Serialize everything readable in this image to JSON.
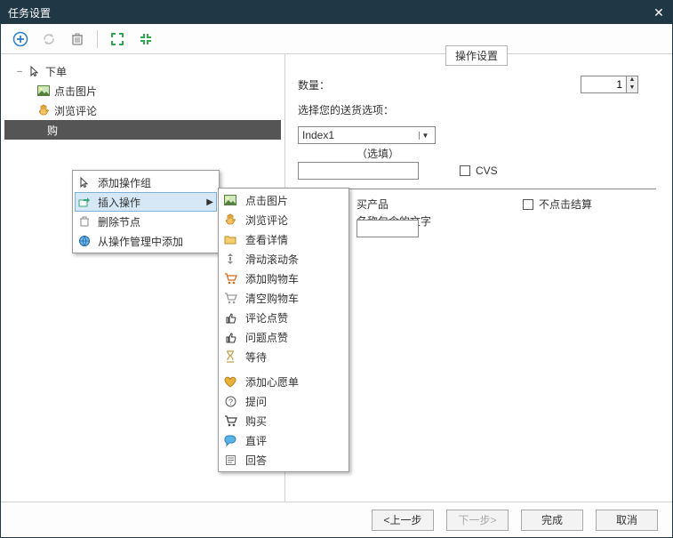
{
  "window": {
    "title": "任务设置"
  },
  "toolbar": {
    "items": [
      "add",
      "sync",
      "trash",
      "sep",
      "fit-green",
      "fit-green-2"
    ]
  },
  "tree": {
    "root": {
      "label": "下单",
      "icon": "cursor"
    },
    "children": [
      {
        "label": "点击图片",
        "icon": "image"
      },
      {
        "label": "浏览评论",
        "icon": "hand"
      },
      {
        "label": "购",
        "icon": "cart",
        "selected": true
      }
    ]
  },
  "context_menu": {
    "items": [
      {
        "label": "添加操作组",
        "icon": "cursor"
      },
      {
        "label": "插入操作",
        "icon": "insert",
        "submenu": true,
        "hover": true
      },
      {
        "label": "删除节点",
        "icon": "trash"
      },
      {
        "label": "从操作管理中添加",
        "icon": "globe"
      }
    ]
  },
  "sub_menu": {
    "items": [
      {
        "label": "点击图片",
        "icon": "image"
      },
      {
        "label": "浏览评论",
        "icon": "hand"
      },
      {
        "label": "查看详情",
        "icon": "folder"
      },
      {
        "label": "滑动滚动条",
        "icon": "scroll"
      },
      {
        "label": "添加购物车",
        "icon": "cart-add"
      },
      {
        "label": "清空购物车",
        "icon": "cart-empty"
      },
      {
        "label": "评论点赞",
        "icon": "thumb"
      },
      {
        "label": "问题点赞",
        "icon": "thumb"
      },
      {
        "label": "等待",
        "icon": "hourglass"
      },
      {
        "label": "添加心愿单",
        "icon": "heart"
      },
      {
        "label": "提问",
        "icon": "question"
      },
      {
        "label": "购买",
        "icon": "cart-buy"
      },
      {
        "label": "直评",
        "icon": "chat"
      },
      {
        "label": "回答",
        "icon": "answer"
      }
    ]
  },
  "right": {
    "tab": "操作设置",
    "qty_label": "数量：",
    "qty_value": "1",
    "shipping_label": "选择您的送货选项：",
    "shipping_value": "Index1",
    "optional_suffix": "（选填）",
    "cvs_label": "CVS",
    "buy_suffix": "买产品",
    "no_checkout_label": "不点击结算",
    "name_contains_suffix": "名称包含的文字"
  },
  "footer": {
    "prev": "<上一步",
    "next": "下一步>",
    "finish": "完成",
    "cancel": "取消"
  }
}
